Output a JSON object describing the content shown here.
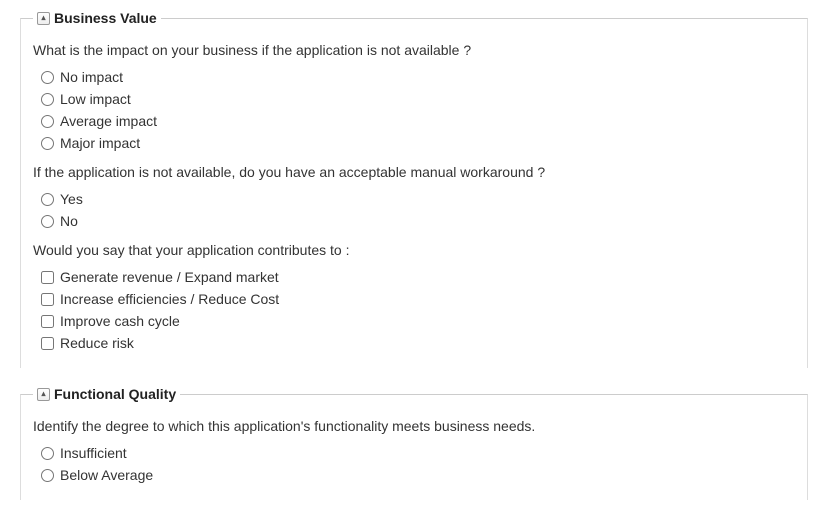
{
  "sections": {
    "business_value": {
      "title": "Business Value",
      "q1": {
        "text": "What is the impact on your business if the application is not available ?",
        "options": [
          "No impact",
          "Low impact",
          "Average impact",
          "Major impact"
        ]
      },
      "q2": {
        "text": "If the application is not available, do you have an acceptable manual workaround ?",
        "options": [
          "Yes",
          "No"
        ]
      },
      "q3": {
        "text": "Would you say that your application contributes to :",
        "options": [
          "Generate revenue / Expand market",
          "Increase efficiencies / Reduce Cost",
          "Improve cash cycle",
          "Reduce risk"
        ]
      }
    },
    "functional_quality": {
      "title": "Functional Quality",
      "q1": {
        "text": "Identify the degree to which this application's functionality meets  business needs.",
        "options": [
          "Insufficient",
          "Below Average"
        ]
      }
    }
  }
}
